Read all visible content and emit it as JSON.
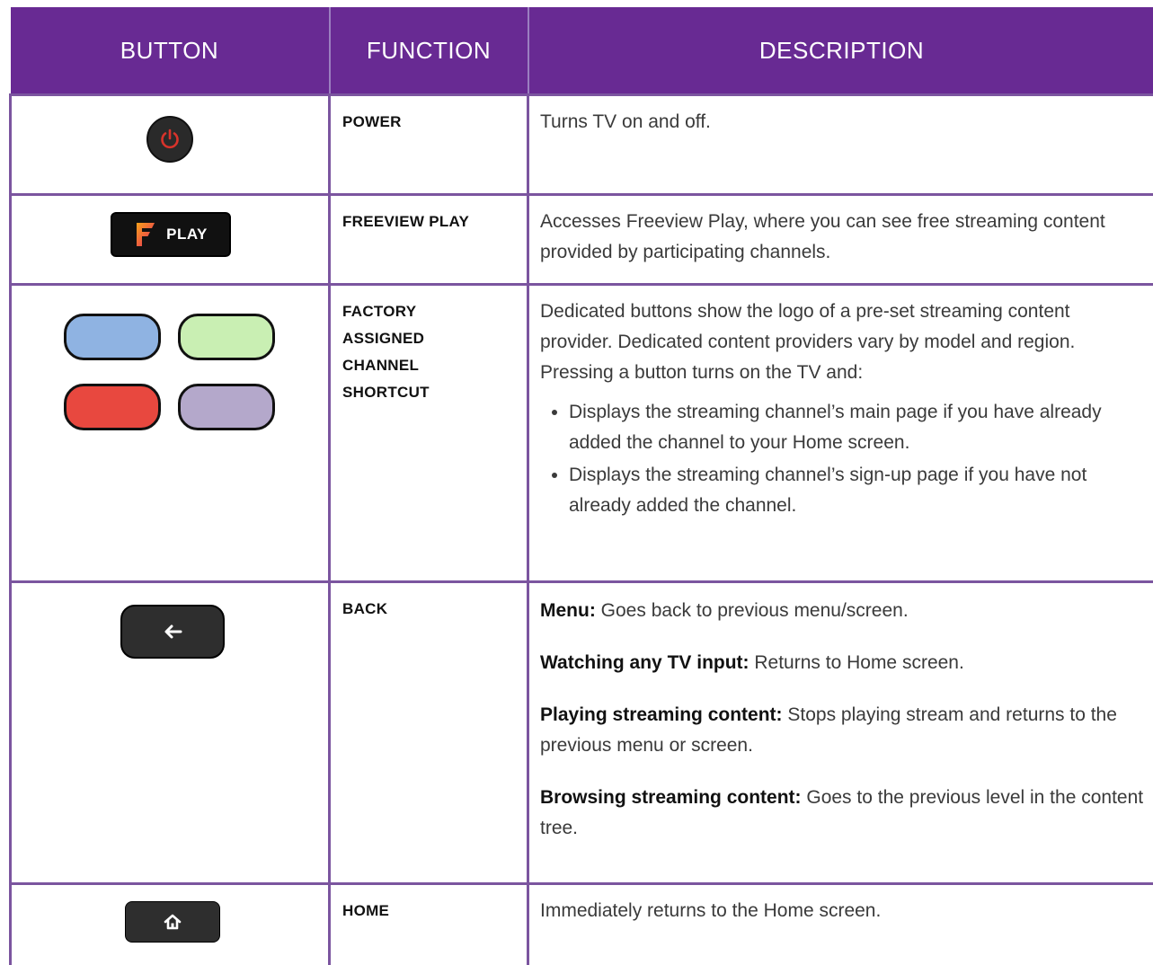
{
  "headers": [
    "BUTTON",
    "FUNCTION",
    "DESCRIPTION"
  ],
  "colors": {
    "header_bg": "#682a93",
    "grid": "#7b559f",
    "shortcut_blue": "#8fb3e2",
    "shortcut_green": "#c9efb3",
    "shortcut_red": "#e8483f",
    "shortcut_purple": "#b4a8cb"
  },
  "rows": [
    {
      "icon": "power-icon",
      "function": "POWER",
      "description": "Turns TV on and off."
    },
    {
      "icon": "freeview-play-icon",
      "button_label": "PLAY",
      "function": "FREEVIEW PLAY",
      "description": "Accesses Freeview Play, where you can see free streaming content provided by participating channels."
    },
    {
      "icon": "channel-shortcut-buttons",
      "function_lines": [
        "FACTORY",
        "ASSIGNED",
        "CHANNEL",
        "SHORTCUT"
      ],
      "description": "Dedicated buttons show the logo of a pre-set streaming content provider. Dedicated content providers vary by model and region. Pressing a button turns on the TV and:",
      "bullets": [
        "Displays the streaming channel’s main page if you have already added the channel to your Home screen.",
        "Displays the streaming channel’s sign-up page if you have not already added the channel."
      ]
    },
    {
      "icon": "back-arrow-icon",
      "function": "BACK",
      "items": [
        {
          "label": "Menu:",
          "text": " Goes back to previous menu/screen."
        },
        {
          "label": "Watching any TV input:",
          "text": " Returns to Home screen."
        },
        {
          "label": "Playing streaming content:",
          "text": " Stops playing stream and returns to the previous menu or screen."
        },
        {
          "label": "Browsing streaming content:",
          "text": " Goes to the previous level in the content tree."
        }
      ]
    },
    {
      "icon": "home-icon",
      "function": "HOME",
      "description": "Immediately returns to the Home screen."
    }
  ]
}
